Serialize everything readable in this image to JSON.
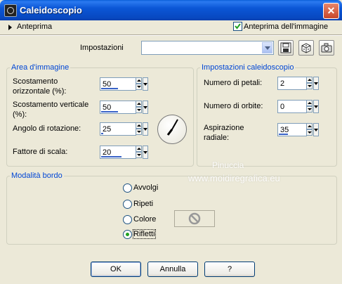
{
  "window": {
    "title": "Caleidoscopio",
    "close_glyph": "✕"
  },
  "preview": {
    "toggle_label": "Anteprima",
    "image_preview_label": "Anteprima dell'immagine",
    "image_preview_checked": true
  },
  "settings": {
    "label": "Impostazioni",
    "value": ""
  },
  "image_area": {
    "legend": "Area d'immagine",
    "h_offset": {
      "label_line1": "Scostamento",
      "label_line2": "orizzontale (%):",
      "value": "50",
      "level": 0.5
    },
    "v_offset": {
      "label_line1": "Scostamento verticale",
      "label_line2": "(%):",
      "value": "50",
      "level": 0.5
    },
    "rotation": {
      "label": "Angolo di rotazione:",
      "value": "25",
      "level": 0.07
    },
    "scale": {
      "label": "Fattore di scala:",
      "value": "20",
      "level": 0.6
    }
  },
  "kaleido": {
    "legend": "Impostazioni caleidoscopio",
    "petals": {
      "label": "Numero di petali:",
      "value": "2"
    },
    "orbits": {
      "label": "Numero di orbite:",
      "value": "0"
    },
    "suction": {
      "label_line1": "Aspirazione",
      "label_line2": "radiale:",
      "value": "35",
      "level": 0.35
    }
  },
  "border": {
    "legend": "Modalità bordo",
    "options": [
      {
        "label": "Avvolgi",
        "checked": false
      },
      {
        "label": "Ripeti",
        "checked": false
      },
      {
        "label": "Colore",
        "checked": false
      },
      {
        "label": "Rifletti",
        "checked": true
      }
    ]
  },
  "watermark": {
    "line1": "Pinuccia",
    "line2": "www.moldiregrafica.eu"
  },
  "buttons": {
    "ok": "OK",
    "cancel": "Annulla",
    "help": "?"
  },
  "colors": {
    "titlebar": "#0a54d0",
    "dialog_bg": "#ece9d8",
    "legend_text": "#0046d5",
    "radio_dot": "#21a121"
  }
}
